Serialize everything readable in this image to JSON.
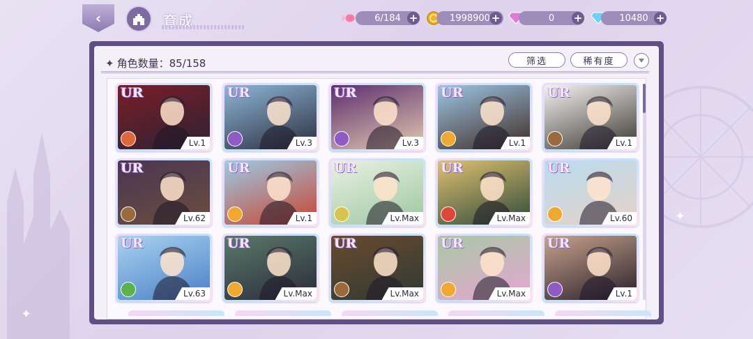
{
  "header": {
    "title": "育成",
    "resources": [
      {
        "icon": "candy-icon",
        "value": "6/184"
      },
      {
        "icon": "gold-coin-icon",
        "value": "1998900"
      },
      {
        "icon": "pink-gem-icon",
        "value": "0"
      },
      {
        "icon": "blue-diamond-icon",
        "value": "10480"
      }
    ]
  },
  "panel": {
    "count_label": "角色数量：85/158",
    "filter_label": "筛选",
    "rarity_label": "稀有度"
  },
  "cards": [
    {
      "rarity": "UR",
      "level": "Lv.1",
      "role_color": "#e0673a",
      "bg": [
        "#7a1e27",
        "#2d2233"
      ]
    },
    {
      "rarity": "UR",
      "level": "Lv.3",
      "role_color": "#8e5bc7",
      "bg": [
        "#8db7d8",
        "#2b2e3c"
      ]
    },
    {
      "rarity": "UR",
      "level": "Lv.3",
      "role_color": "#8e5bc7",
      "bg": [
        "#5b2e6e",
        "#e4c9b0"
      ]
    },
    {
      "rarity": "UR",
      "level": "Lv.1",
      "role_color": "#f0a92c",
      "bg": [
        "#9cc6e4",
        "#402b25"
      ]
    },
    {
      "rarity": "UR",
      "level": "Lv.1",
      "role_color": "#9a6a3c",
      "bg": [
        "#f3f3ef",
        "#3c3833"
      ]
    },
    {
      "rarity": "UR",
      "level": "Lv.62",
      "role_color": "#9a6a3c",
      "bg": [
        "#4a3654",
        "#6b4e3d"
      ]
    },
    {
      "rarity": "UR",
      "level": "Lv.1",
      "role_color": "#f0a92c",
      "bg": [
        "#9ccbe6",
        "#c8452f"
      ]
    },
    {
      "rarity": "UR",
      "level": "Lv.Max",
      "role_color": "#d9c34a",
      "bg": [
        "#e9f1e3",
        "#9dc7a0"
      ]
    },
    {
      "rarity": "UR",
      "level": "Lv.Max",
      "role_color": "#e0473a",
      "bg": [
        "#dfc170",
        "#2f4a3a"
      ]
    },
    {
      "rarity": "UR",
      "level": "Lv.60",
      "role_color": "#f0a92c",
      "bg": [
        "#b8dbf0",
        "#e6d2c6"
      ]
    },
    {
      "rarity": "UR",
      "level": "Lv.63",
      "role_color": "#5bb44a",
      "bg": [
        "#a9d3ef",
        "#4a7fc8"
      ]
    },
    {
      "rarity": "UR",
      "level": "Lv.Max",
      "role_color": "#f0a92c",
      "bg": [
        "#5a7a6a",
        "#2b2a3a"
      ]
    },
    {
      "rarity": "UR",
      "level": "Lv.Max",
      "role_color": "#9a6a3c",
      "bg": [
        "#6b4a2e",
        "#2d3a33"
      ]
    },
    {
      "rarity": "UR",
      "level": "Lv.Max",
      "role_color": "#f0a92c",
      "bg": [
        "#a7c9a3",
        "#e7a5d3"
      ]
    },
    {
      "rarity": "UR",
      "level": "Lv.1",
      "role_color": "#8e5bc7",
      "bg": [
        "#c6a38c",
        "#2a1f2a"
      ]
    }
  ],
  "colors": {
    "panel_frame": "#5f4f86",
    "accent": "#8a7aa8"
  }
}
